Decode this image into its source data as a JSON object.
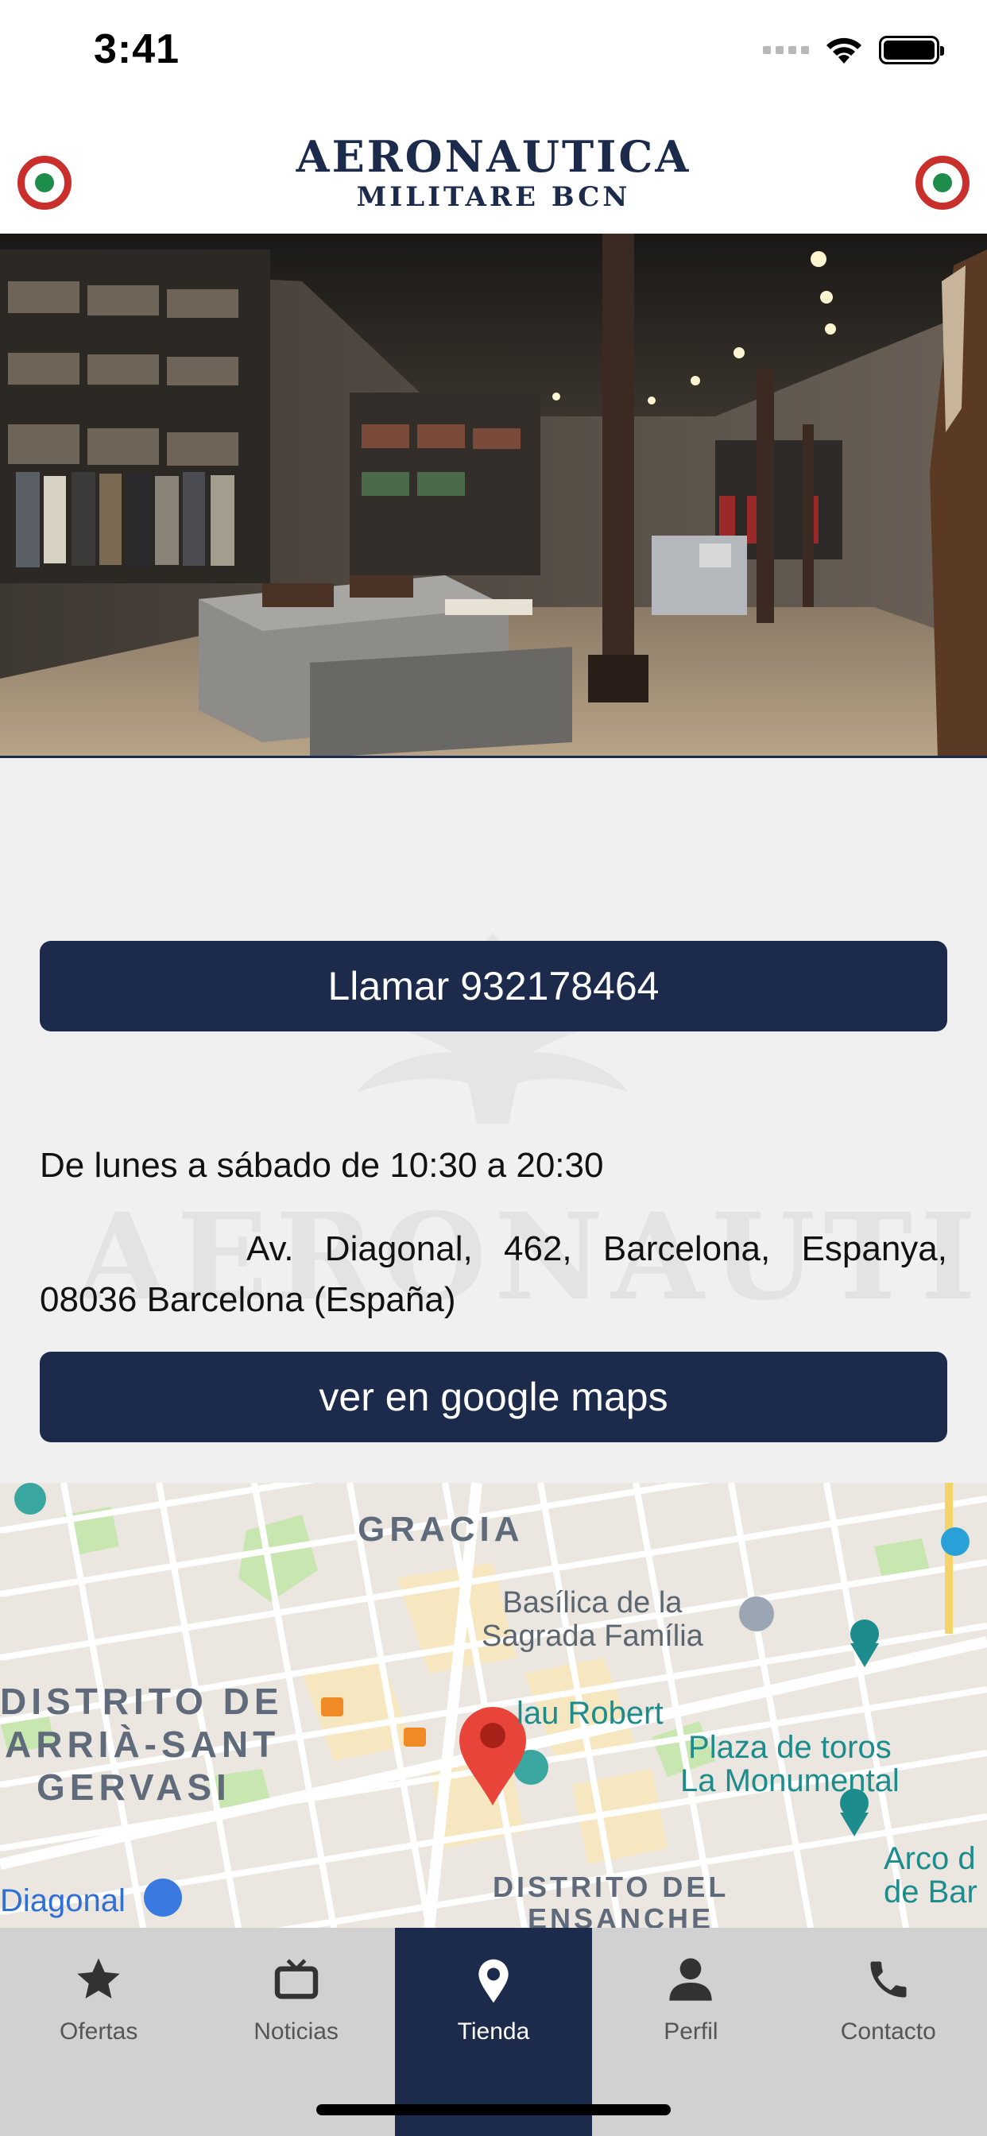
{
  "status_bar": {
    "time": "3:41"
  },
  "header": {
    "brand_line1": "AERONAUTICA",
    "brand_line2": "MILITARE  BCN"
  },
  "store": {
    "call_button_label": "Llamar 932178464",
    "hours": "De lunes a sábado de 10:30 a 20:30",
    "address": "Av. Diagonal, 462, Barcelona, Espanya, 08036 Barcelona (España)",
    "maps_button_label": "ver en google maps",
    "watermark": "AERONAUTICA"
  },
  "map": {
    "labels": {
      "gracia": "GRACIA",
      "basilica": "Basílica de la\nSagrada Família",
      "sarria1": "DISTRITO DE",
      "sarria2": "ARRIÀ-SANT",
      "sarria3": "GERVASI",
      "robert": "lau Robert",
      "plaza": "Plaza de toros\nLa Monumental",
      "arco": "Arco d\nde Bar",
      "diagonal": "Diagonal",
      "eixample1": "DISTRITO DEL",
      "eixample2": "ENSANCHE"
    }
  },
  "tabs": [
    {
      "label": "Ofertas",
      "icon": "star-icon"
    },
    {
      "label": "Noticias",
      "icon": "tv-icon"
    },
    {
      "label": "Tienda",
      "icon": "location-pin-icon",
      "active": true
    },
    {
      "label": "Perfil",
      "icon": "person-icon"
    },
    {
      "label": "Contacto",
      "icon": "phone-icon"
    }
  ],
  "colors": {
    "navy": "#1c2a4b",
    "roundel_red": "#c9302c",
    "roundel_green": "#1e8c4a",
    "tabbar_bg": "#d1d1d1",
    "map_pin": "#e8443a"
  }
}
